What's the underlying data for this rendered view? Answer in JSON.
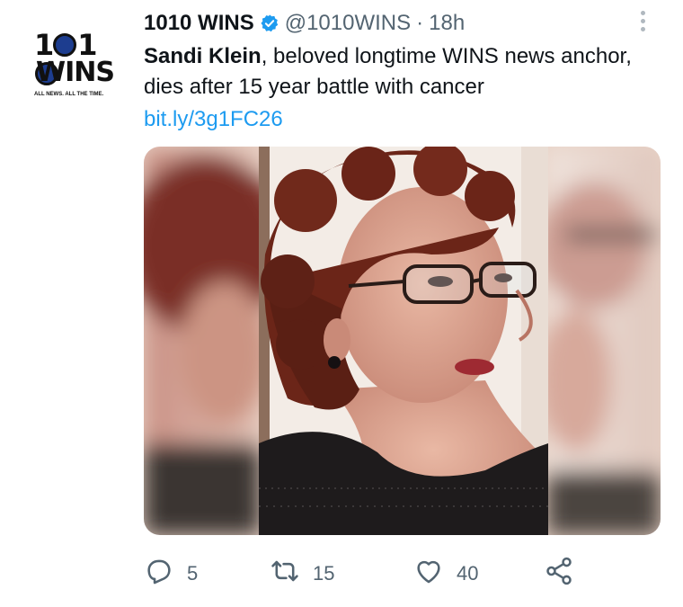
{
  "avatar": {
    "logo_number": "1010",
    "logo_word": "WINS",
    "logo_tagline": "ALL NEWS. ALL THE TIME."
  },
  "header": {
    "display_name": "1010 WINS",
    "handle": "@1010WINS",
    "separator": "·",
    "time": "18h"
  },
  "tweet": {
    "bold_lead": "Sandi Klein",
    "text": ", beloved longtime WINS news anchor, dies after 15 year battle with cancer",
    "link": "bit.ly/3g1FC26"
  },
  "actions": {
    "replies": "5",
    "retweets": "15",
    "likes": "40"
  },
  "icons": [
    "verified-badge-icon",
    "more-options-icon",
    "reply-icon",
    "retweet-icon",
    "like-icon",
    "share-icon"
  ],
  "colors": {
    "link": "#1d9bf0",
    "verified": "#1d9bf0",
    "muted": "#536471",
    "text": "#0f1419"
  }
}
